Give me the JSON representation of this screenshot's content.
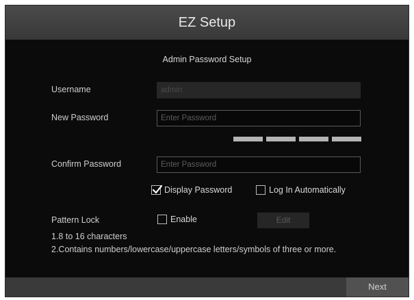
{
  "dialog": {
    "title": "EZ Setup",
    "section_title": "Admin Password Setup"
  },
  "form": {
    "username_label": "Username",
    "username_value": "admin",
    "new_password_label": "New Password",
    "new_password_placeholder": "Enter Password",
    "confirm_password_label": "Confirm Password",
    "confirm_password_placeholder": "Enter Password",
    "strength_segments": 4
  },
  "options": {
    "display_password_label": "Display Password",
    "display_password_checked": true,
    "auto_login_label": "Log In Automatically",
    "auto_login_checked": false
  },
  "pattern_lock": {
    "label": "Pattern Lock",
    "enable_label": "Enable",
    "enable_checked": false,
    "edit_label": "Edit"
  },
  "hints": {
    "line1": "1.8 to 16 characters",
    "line2": "2.Contains numbers/lowercase/uppercase letters/symbols of three or more."
  },
  "footer": {
    "next_label": "Next"
  },
  "colors": {
    "background": "#0b0b0b",
    "titlebar": "#404040",
    "strength_bar": "#b4b4b4"
  }
}
